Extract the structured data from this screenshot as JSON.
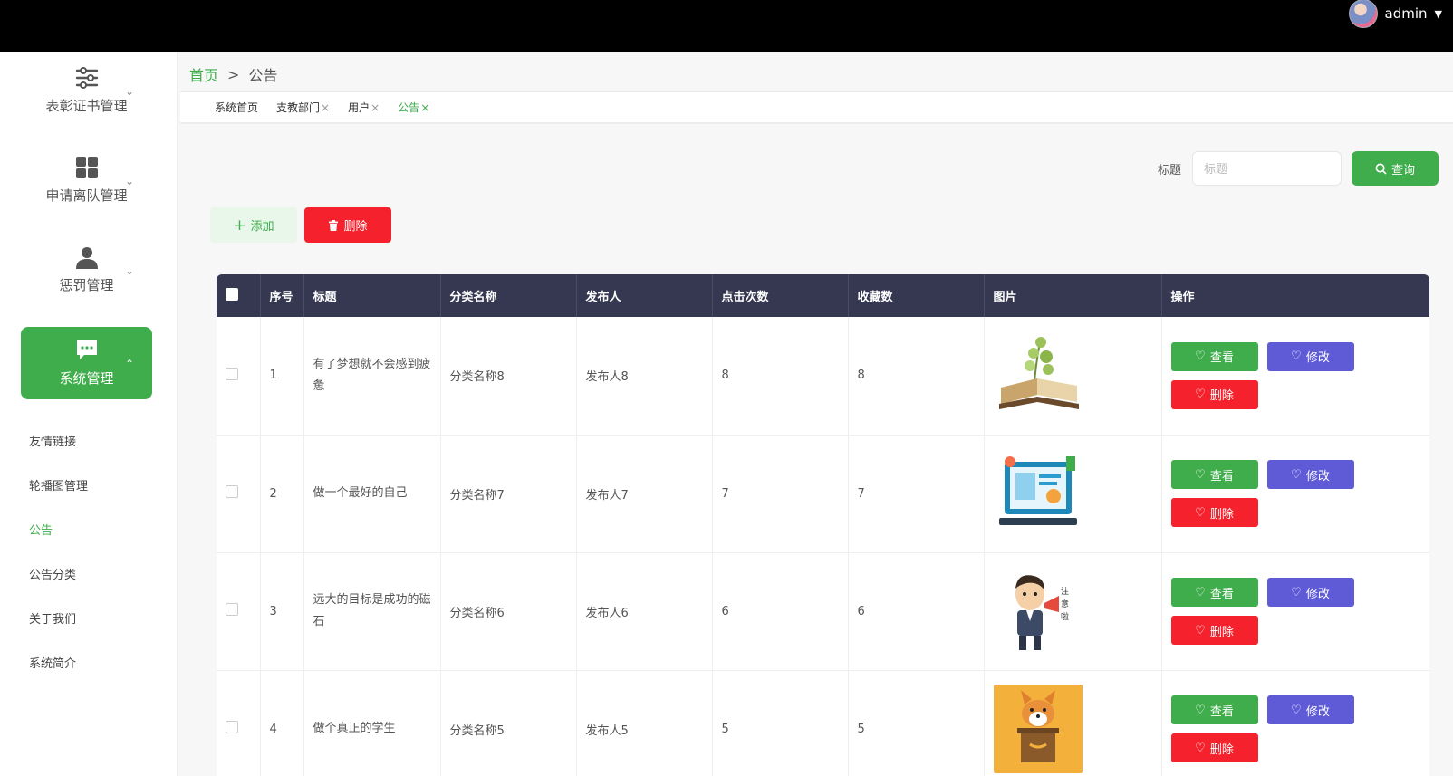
{
  "user": {
    "name": "admin"
  },
  "sidebar": {
    "groups": [
      {
        "label": "表彰证书管理",
        "icon": "sliders-icon"
      },
      {
        "label": "申请离队管理",
        "icon": "grid-icon"
      },
      {
        "label": "惩罚管理",
        "icon": "user-icon"
      },
      {
        "label": "系统管理",
        "icon": "chat-icon"
      }
    ],
    "sub_items": [
      "友情链接",
      "轮播图管理",
      "公告",
      "公告分类",
      "关于我们",
      "系统简介"
    ]
  },
  "breadcrumb": {
    "home": "首页",
    "sep": ">",
    "current": "公告"
  },
  "tabs": [
    {
      "label": "系统首页",
      "close": ""
    },
    {
      "label": "支教部门",
      "close": "×"
    },
    {
      "label": "用户",
      "close": "×"
    },
    {
      "label": "公告",
      "close": "×"
    }
  ],
  "search": {
    "label": "标题",
    "placeholder": "标题",
    "button": "查询"
  },
  "actions": {
    "add": "添加",
    "delete": "删除"
  },
  "table": {
    "headers": [
      "序号",
      "标题",
      "分类名称",
      "发布人",
      "点击次数",
      "收藏数",
      "图片",
      "操作"
    ],
    "op_labels": {
      "view": "查看",
      "edit": "修改",
      "remove": "删除"
    },
    "rows": [
      {
        "no": "1",
        "title": "有了梦想就不会感到疲惫",
        "category": "分类名称8",
        "publisher": "发布人8",
        "clicks": "8",
        "favorites": "8",
        "image": "book-plant-image"
      },
      {
        "no": "2",
        "title": "做一个最好的自己",
        "category": "分类名称7",
        "publisher": "发布人7",
        "clicks": "7",
        "favorites": "7",
        "image": "monitor-illustration-image"
      },
      {
        "no": "3",
        "title": "远大的目标是成功的磁石",
        "category": "分类名称6",
        "publisher": "发布人6",
        "clicks": "6",
        "favorites": "6",
        "image": "businessman-megaphone-image"
      },
      {
        "no": "4",
        "title": "做个真正的学生",
        "category": "分类名称5",
        "publisher": "发布人5",
        "clicks": "5",
        "favorites": "5",
        "image": "corgi-podium-image"
      }
    ]
  },
  "colors": {
    "primary": "#3fad4b",
    "danger": "#f5222d",
    "edit": "#5f5ad6",
    "table_header": "#363852"
  }
}
